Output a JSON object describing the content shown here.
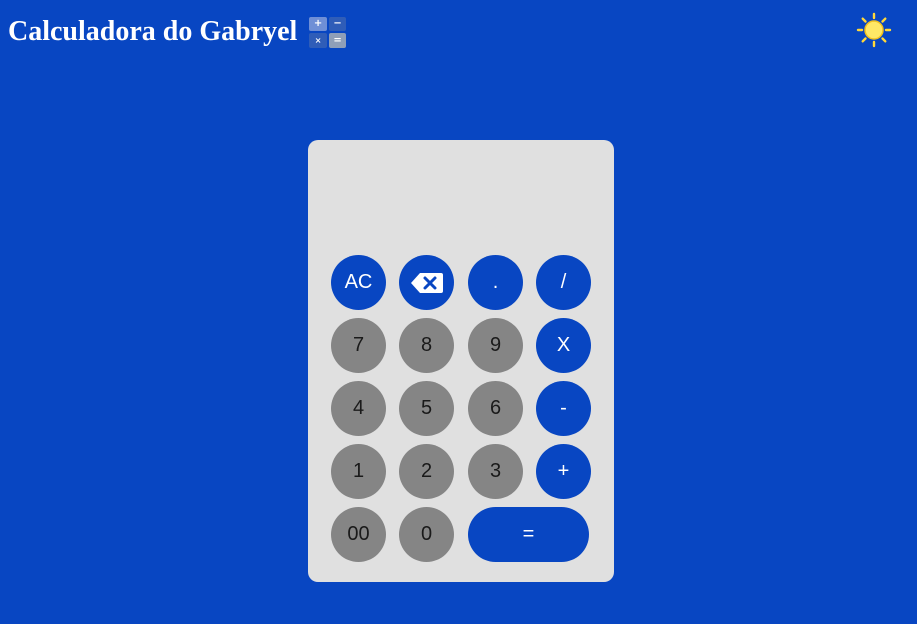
{
  "header": {
    "title": "Calculadora do Gabryel",
    "icon_name": "calculator-icon",
    "icon_symbols": {
      "plus": "+",
      "minus": "−",
      "times": "×",
      "equals": "="
    }
  },
  "theme_toggle": {
    "icon_name": "sun-icon",
    "color": "#ffd83a"
  },
  "display": {
    "value": ""
  },
  "keys": {
    "clear": "AC",
    "backspace_icon": "backspace-icon",
    "decimal": ".",
    "divide": "/",
    "seven": "7",
    "eight": "8",
    "nine": "9",
    "multiply": "X",
    "four": "4",
    "five": "5",
    "six": "6",
    "subtract": "-",
    "one": "1",
    "two": "2",
    "three": "3",
    "add": "+",
    "double_zero": "00",
    "zero": "0",
    "equals": "="
  },
  "colors": {
    "background": "#0846c2",
    "panel": "#e0e0e0",
    "number_key": "#858585",
    "operator_key": "#0846c2"
  }
}
